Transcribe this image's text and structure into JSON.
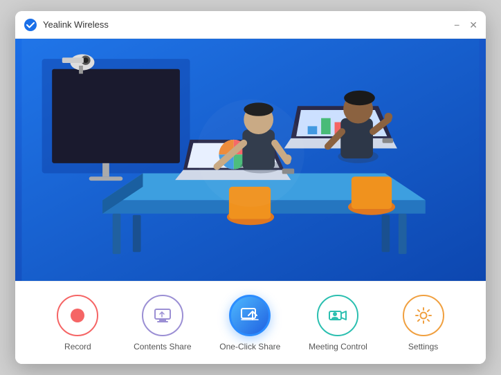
{
  "window": {
    "title": "Yealink Wireless",
    "minimize_label": "−",
    "close_label": "✕"
  },
  "toolbar": {
    "items": [
      {
        "id": "record",
        "label": "Record",
        "icon_type": "record"
      },
      {
        "id": "contents-share",
        "label": "Contents Share",
        "icon_type": "contents"
      },
      {
        "id": "oneclick-share",
        "label": "One-Click Share",
        "icon_type": "oneclick"
      },
      {
        "id": "meeting-control",
        "label": "Meeting Control",
        "icon_type": "meeting"
      },
      {
        "id": "settings",
        "label": "Settings",
        "icon_type": "settings"
      }
    ]
  }
}
